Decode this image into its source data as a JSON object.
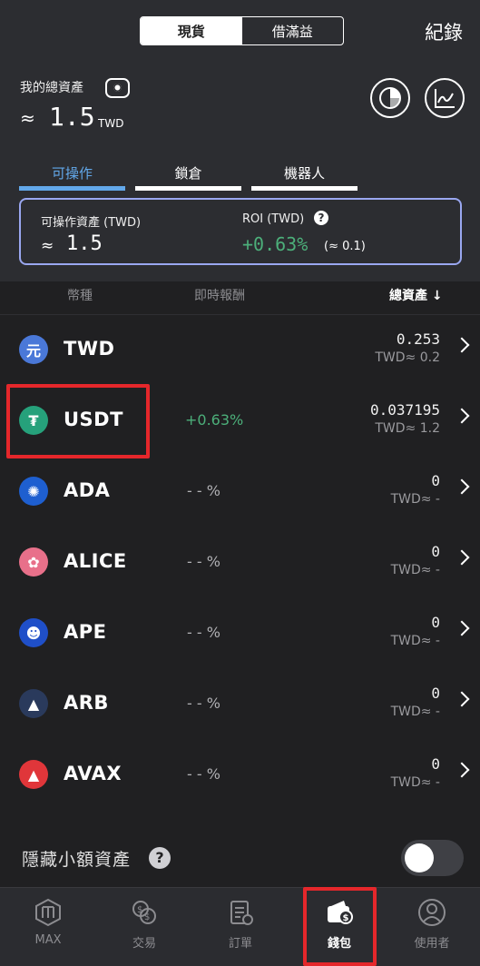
{
  "header": {
    "segment": {
      "spot": "現貨",
      "margin": "借滿益"
    },
    "records_label": "紀錄",
    "total_assets_label": "我的總資產",
    "total_assets_approx": "≈",
    "total_assets_value": "1.5",
    "total_assets_unit": "TWD",
    "icons": {
      "visibility": "eye-icon",
      "allocation": "pie-chart-icon",
      "performance": "line-chart-icon"
    }
  },
  "subtabs": [
    "可操作",
    "鎖倉",
    "機器人"
  ],
  "infobox": {
    "available_label": "可操作資產 (TWD)",
    "available_approx": "≈",
    "available_value": "1.5",
    "roi_label": "ROI (TWD)",
    "roi_help": "?",
    "roi_value": "+0.63%",
    "roi_sub": "(≈ 0.1)"
  },
  "columns": {
    "currency": "幣種",
    "pnl": "即時報酬",
    "total": "總資產 ↓"
  },
  "rows": [
    {
      "symbol": "TWD",
      "icon": "twd-icon",
      "glyph": "元",
      "color": "#4a78d8",
      "change": "",
      "amount": "0.253",
      "twd": "TWD≈ 0.2"
    },
    {
      "symbol": "USDT",
      "icon": "usdt-icon",
      "glyph": "₮",
      "color": "#26a17b",
      "change": "+0.63%",
      "amount": "0.037195",
      "twd": "TWD≈ 1.2"
    },
    {
      "symbol": "ADA",
      "icon": "ada-icon",
      "glyph": "✺",
      "color": "#1e5fd0",
      "change": "- - %",
      "amount": "0",
      "twd": "TWD≈ -"
    },
    {
      "symbol": "ALICE",
      "icon": "alice-icon",
      "glyph": "✿",
      "color": "#e8708a",
      "change": "- - %",
      "amount": "0",
      "twd": "TWD≈ -"
    },
    {
      "symbol": "APE",
      "icon": "ape-icon",
      "glyph": "☻",
      "color": "#1f4fc8",
      "change": "- - %",
      "amount": "0",
      "twd": "TWD≈ -"
    },
    {
      "symbol": "ARB",
      "icon": "arb-icon",
      "glyph": "▲",
      "color": "#2a3a5c",
      "change": "- - %",
      "amount": "0",
      "twd": "TWD≈ -"
    },
    {
      "symbol": "AVAX",
      "icon": "avax-icon",
      "glyph": "▲",
      "color": "#e0363a",
      "change": "- - %",
      "amount": "0",
      "twd": "TWD≈ -"
    }
  ],
  "hide_small": {
    "label": "隱藏小額資產",
    "help": "?"
  },
  "nav": [
    {
      "label": "MAX",
      "icon": "max-logo-icon"
    },
    {
      "label": "交易",
      "icon": "exchange-icon"
    },
    {
      "label": "訂單",
      "icon": "orders-icon"
    },
    {
      "label": "錢包",
      "icon": "wallet-icon"
    },
    {
      "label": "使用者",
      "icon": "user-icon"
    }
  ]
}
